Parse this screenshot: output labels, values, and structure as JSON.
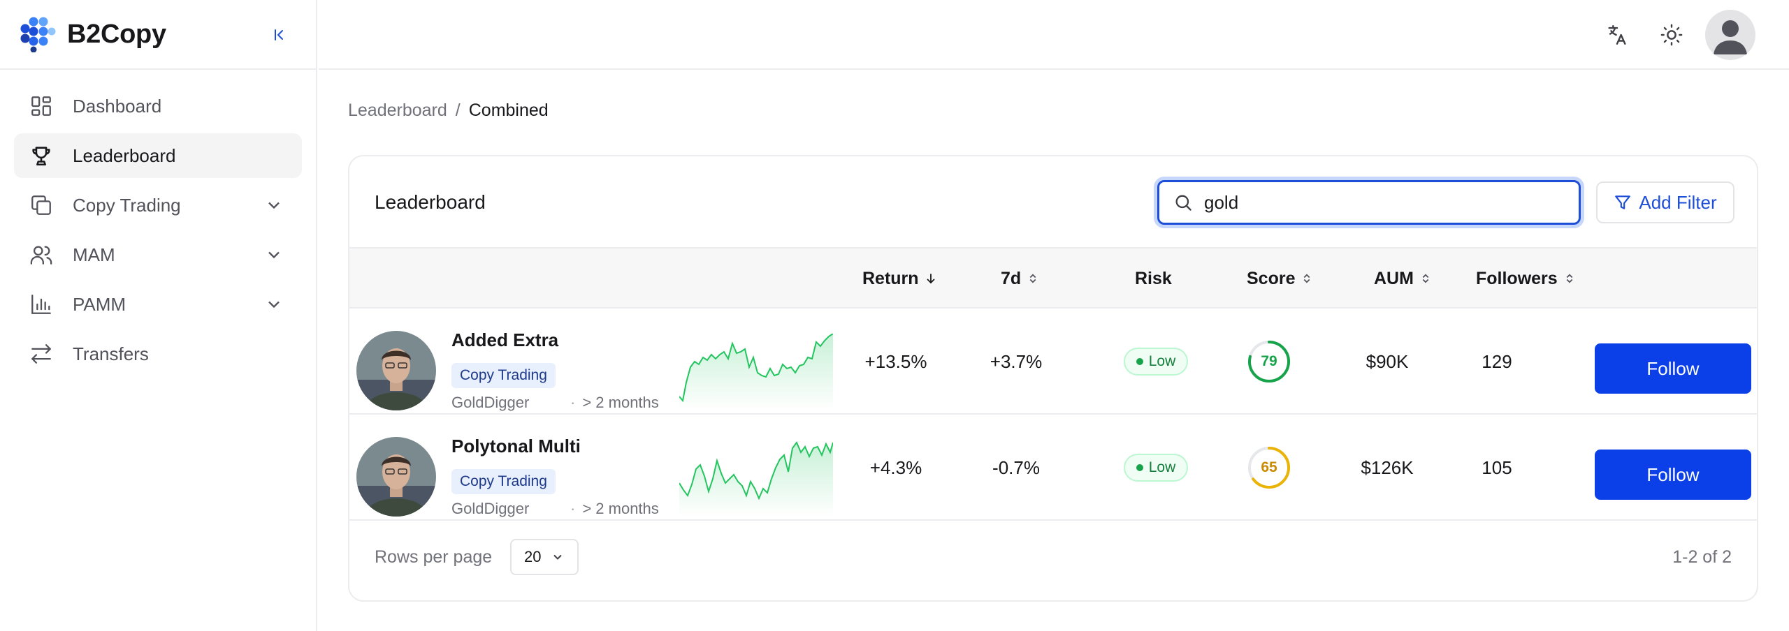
{
  "app": {
    "name": "B2Copy"
  },
  "sidebar": {
    "items": [
      {
        "label": "Dashboard",
        "icon": "dashboard-icon"
      },
      {
        "label": "Leaderboard",
        "icon": "trophy-icon",
        "active": true
      },
      {
        "label": "Copy Trading",
        "icon": "copy-icon",
        "expandable": true
      },
      {
        "label": "MAM",
        "icon": "users-icon",
        "expandable": true
      },
      {
        "label": "PAMM",
        "icon": "bar-chart-icon",
        "expandable": true
      },
      {
        "label": "Transfers",
        "icon": "transfer-icon"
      }
    ]
  },
  "topbar": {
    "icons": [
      "translate-icon",
      "sun-icon",
      "user-avatar-icon"
    ]
  },
  "breadcrumb": {
    "parent": "Leaderboard",
    "separator": "/",
    "current": "Combined"
  },
  "leaderboard": {
    "title": "Leaderboard",
    "search_value": "gold",
    "add_filter_label": "Add Filter",
    "columns": {
      "return": "Return",
      "d7": "7d",
      "risk": "Risk",
      "score": "Score",
      "aum": "AUM",
      "followers": "Followers"
    },
    "rows": [
      {
        "name": "Added Extra",
        "tag": "Copy Trading",
        "owner": "GoldDigger",
        "duration": "> 2 months",
        "return": "+13.5%",
        "d7": "+3.7%",
        "risk": "Low",
        "score": "79",
        "score_color": "#16a34a",
        "score_fraction": 0.79,
        "aum": "$90K",
        "followers": "129",
        "follow_label": "Follow"
      },
      {
        "name": "Polytonal Multi",
        "tag": "Copy Trading",
        "owner": "GoldDigger",
        "duration": "> 2 months",
        "return": "+4.3%",
        "d7": "-0.7%",
        "risk": "Low",
        "score": "65",
        "score_color": "#eab308",
        "score_fraction": 0.65,
        "aum": "$126K",
        "followers": "105",
        "follow_label": "Follow"
      }
    ],
    "footer": {
      "rows_per_page_label": "Rows per page",
      "rows_per_page": "20",
      "range": "1-2 of 2"
    }
  },
  "colors": {
    "primary": "#0b3fe8",
    "accent": "#1d4ed8",
    "positive": "#22c55e"
  }
}
